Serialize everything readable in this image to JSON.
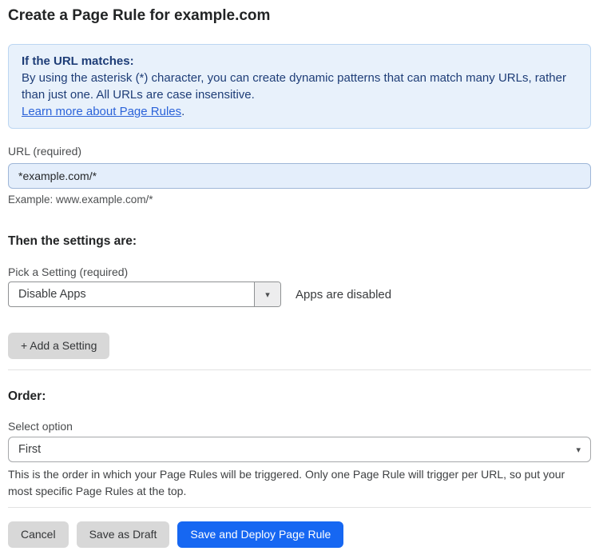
{
  "page": {
    "title": "Create a Page Rule for example.com"
  },
  "info_box": {
    "heading": "If the URL matches:",
    "body": "By using the asterisk (*) character, you can create dynamic patterns that can match many URLs, rather than just one. All URLs are case insensitive.",
    "link_label": "Learn more about Page Rules",
    "link_suffix": "."
  },
  "url_field": {
    "label": "URL (required)",
    "value": "*example.com/*",
    "helper": "Example: www.example.com/*"
  },
  "settings_section": {
    "heading": "Then the settings are:",
    "picker_label": "Pick a Setting (required)",
    "selected_setting": "Disable Apps",
    "caret_icon": "▾",
    "setting_status": "Apps are disabled",
    "add_setting_label": "+ Add a Setting"
  },
  "order_section": {
    "heading": "Order:",
    "select_label": "Select option",
    "selected_option": "First",
    "caret_icon": "▾",
    "helper": "This is the order in which your Page Rules will be triggered. Only one Page Rule will trigger per URL, so put your most specific Page Rules at the top."
  },
  "actions": {
    "cancel": "Cancel",
    "save_draft": "Save as Draft",
    "save_deploy": "Save and Deploy Page Rule"
  },
  "colors": {
    "primary_blue": "#1667f2",
    "info_bg": "#e8f1fb",
    "info_border": "#bcd6f2",
    "info_text": "#1e3d77",
    "link_blue": "#2b63d9",
    "input_bg": "#e4eefb",
    "gray_button": "#d8d8d8"
  }
}
